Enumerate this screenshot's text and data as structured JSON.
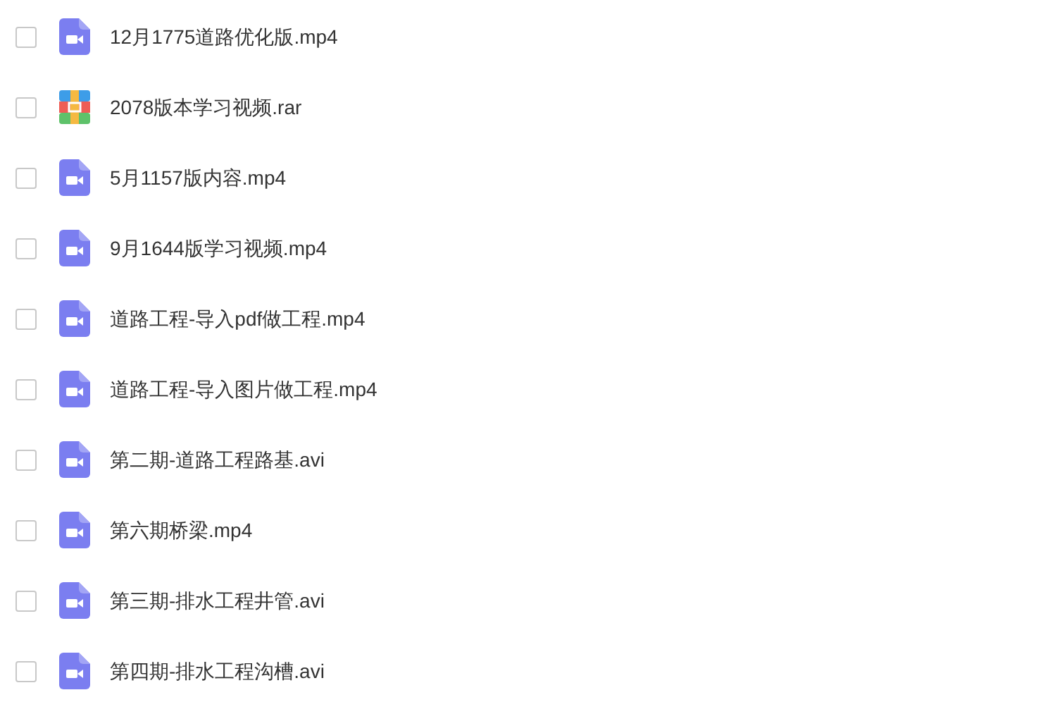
{
  "files": [
    {
      "name": "12月1775道路优化版.mp4",
      "kind": "video",
      "checked": false
    },
    {
      "name": "2078版本学习视频.rar",
      "kind": "archive",
      "checked": false
    },
    {
      "name": "5月1157版内容.mp4",
      "kind": "video",
      "checked": false
    },
    {
      "name": "9月1644版学习视频.mp4",
      "kind": "video",
      "checked": false
    },
    {
      "name": "道路工程-导入pdf做工程.mp4",
      "kind": "video",
      "checked": false
    },
    {
      "name": "道路工程-导入图片做工程.mp4",
      "kind": "video",
      "checked": false
    },
    {
      "name": "第二期-道路工程路基.avi",
      "kind": "video",
      "checked": false
    },
    {
      "name": "第六期桥梁.mp4",
      "kind": "video",
      "checked": false
    },
    {
      "name": "第三期-排水工程井管.avi",
      "kind": "video",
      "checked": false
    },
    {
      "name": "第四期-排水工程沟槽.avi",
      "kind": "video",
      "checked": false
    }
  ]
}
